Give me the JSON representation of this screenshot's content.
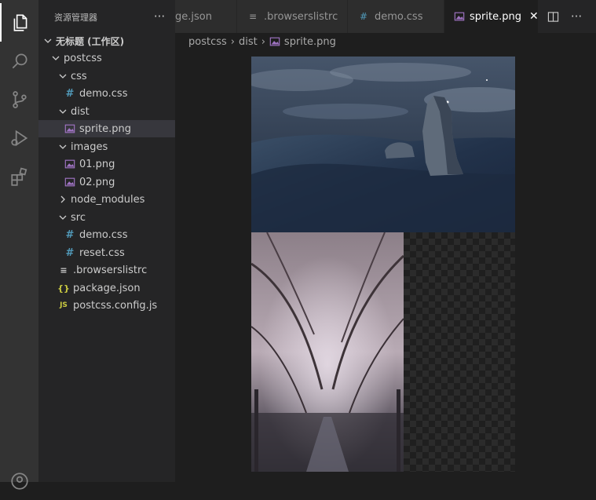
{
  "sidebar": {
    "title": "资源管理器",
    "more_label": "···",
    "tree": [
      {
        "label": "无标题 (工作区)",
        "icon": "chevron-down-icon",
        "bold": true
      },
      {
        "label": "postcss",
        "icon": "chevron-down-icon"
      },
      {
        "label": "css",
        "icon": "chevron-down-icon"
      },
      {
        "label": "demo.css",
        "icon": "css-file-icon",
        "glyph": "#"
      },
      {
        "label": "dist",
        "icon": "chevron-down-icon"
      },
      {
        "label": "sprite.png",
        "icon": "image-file-icon",
        "selected": true
      },
      {
        "label": "images",
        "icon": "chevron-down-icon"
      },
      {
        "label": "01.png",
        "icon": "image-file-icon"
      },
      {
        "label": "02.png",
        "icon": "image-file-icon"
      },
      {
        "label": "node_modules",
        "icon": "chevron-right-icon"
      },
      {
        "label": "src",
        "icon": "chevron-down-icon"
      },
      {
        "label": "demo.css",
        "icon": "css-file-icon",
        "glyph": "#"
      },
      {
        "label": "reset.css",
        "icon": "css-file-icon",
        "glyph": "#"
      },
      {
        "label": ".browserslistrc",
        "icon": "lines-file-icon",
        "glyph": "≡"
      },
      {
        "label": "package.json",
        "icon": "json-file-icon",
        "glyph": "{}"
      },
      {
        "label": "postcss.config.js",
        "icon": "js-file-icon",
        "glyph": "JS"
      }
    ]
  },
  "tabs": [
    {
      "label": "ge.json"
    },
    {
      "label": ".browserslistrc",
      "glyph": "≡"
    },
    {
      "label": "demo.css",
      "glyph": "#"
    },
    {
      "label": "sprite.png",
      "active": true,
      "close": "✕"
    }
  ],
  "tab_actions": {
    "more_label": "···"
  },
  "breadcrumb": {
    "items": [
      "postcss",
      "dist",
      "sprite.png"
    ],
    "separator": "›"
  },
  "colors": {
    "activity_bar": "#333333",
    "sidebar": "#252526",
    "editor": "#1e1e1e",
    "selected_row": "#37373d",
    "css_icon": "#519aba",
    "json_icon": "#cbcb41",
    "image_icon": "#a074c4"
  }
}
